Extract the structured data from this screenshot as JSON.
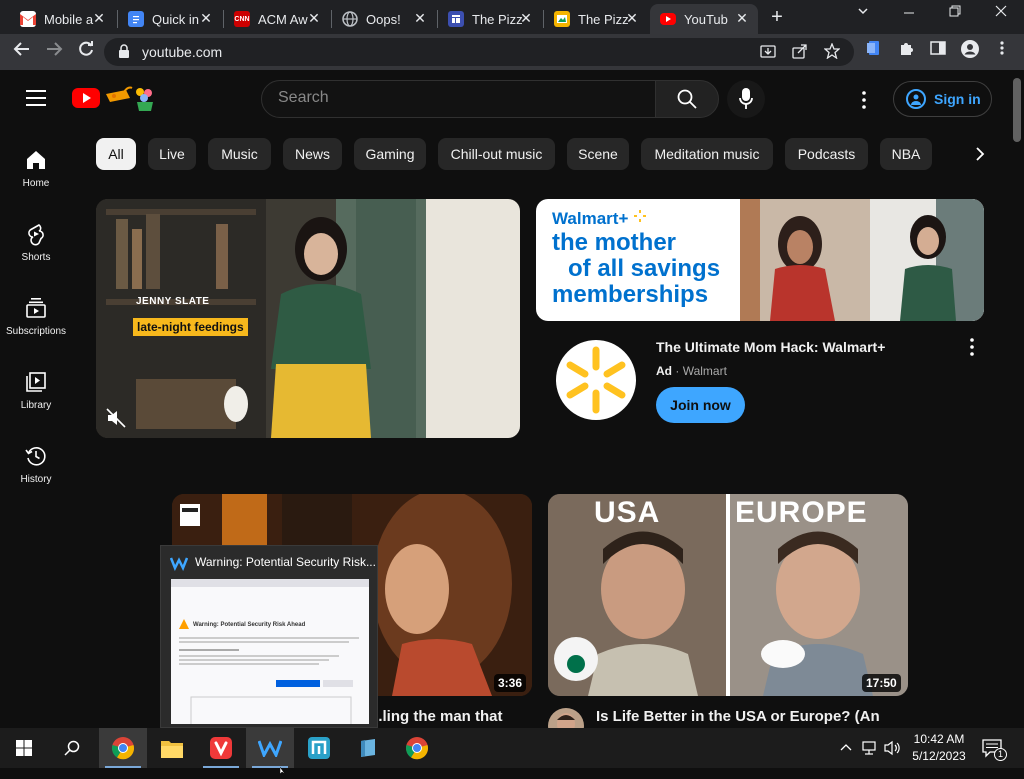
{
  "browser": {
    "tabs": [
      {
        "title": "Mobile a",
        "favicon": "gmail-icon",
        "color": "#ea4335"
      },
      {
        "title": "Quick in",
        "favicon": "docs-icon",
        "color": "#4285f4"
      },
      {
        "title": "ACM Aw",
        "favicon": "cnn-icon",
        "color": "#cc0000"
      },
      {
        "title": "Oops!",
        "favicon": "globe-icon",
        "color": "#9aa0a6"
      },
      {
        "title": "The Pizz",
        "favicon": "forms-icon",
        "color": "#3c4fb0"
      },
      {
        "title": "The Pizz",
        "favicon": "slides-icon",
        "color": "#f4b400"
      },
      {
        "title": "YouTube",
        "favicon": "youtube-icon",
        "color": "#ff0000"
      }
    ],
    "active_tab": 6,
    "url": "youtube.com"
  },
  "youtube": {
    "search_placeholder": "Search",
    "signin_label": "Sign in",
    "sidebar": [
      {
        "label": "Home",
        "icon": "home-icon"
      },
      {
        "label": "Shorts",
        "icon": "shorts-icon"
      },
      {
        "label": "Subscriptions",
        "icon": "subscriptions-icon"
      },
      {
        "label": "Library",
        "icon": "library-icon"
      },
      {
        "label": "History",
        "icon": "history-icon"
      }
    ],
    "chips": [
      "All",
      "Live",
      "Music",
      "News",
      "Gaming",
      "Chill-out music",
      "Scene",
      "Meditation music",
      "Podcasts",
      "NBA"
    ],
    "featured_video": {
      "overlay_name": "JENNY SLATE",
      "overlay_caption": "late-night feedings"
    },
    "ad": {
      "banner_brand": "Walmart+",
      "banner_text_1": "the mother",
      "banner_text_2": "of all savings",
      "banner_text_3": "memberships",
      "title": "The Ultimate Mom Hack: Walmart+",
      "ad_label": "Ad",
      "separator": "·",
      "advertiser": "Walmart",
      "cta": "Join now"
    },
    "videos": [
      {
        "title": "...ling the man that",
        "duration": "3:36"
      },
      {
        "title": "Is Life Better in the USA or Europe? (An",
        "duration": "17:50",
        "thumb_left": "USA",
        "thumb_right": "EUROPE"
      }
    ]
  },
  "taskbar_preview": {
    "title": "Warning: Potential Security Risk...",
    "thumb_heading": "Warning: Potential Security Risk Ahead"
  },
  "taskbar": {
    "time": "10:42 AM",
    "date": "5/12/2023",
    "notification_count": "1"
  }
}
